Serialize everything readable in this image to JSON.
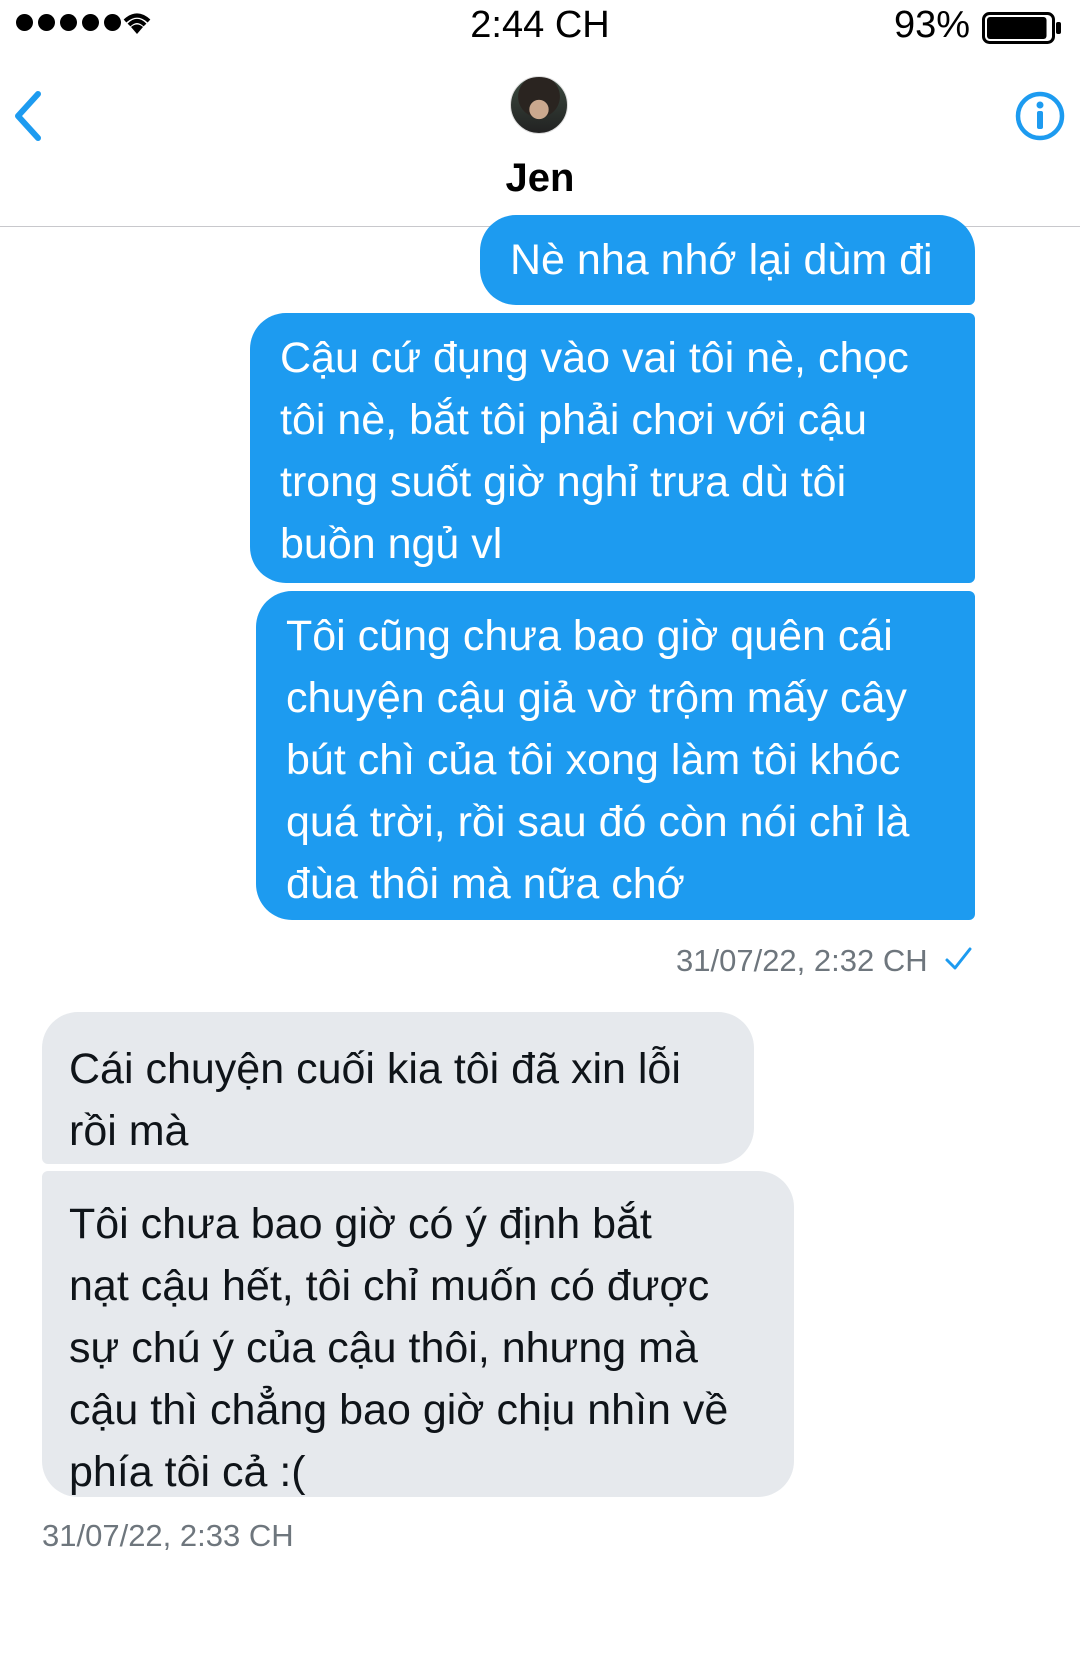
{
  "status_bar": {
    "time": "2:44 CH",
    "battery_percent": "93%",
    "battery_level": 0.93,
    "signal_bars": 5,
    "wifi_icon": "wifi-icon"
  },
  "header": {
    "contact_name": "Jen",
    "back_icon": "chevron-left-icon",
    "info_icon": "info-circle-icon",
    "accent_color": "#1d9bf0"
  },
  "messages": [
    {
      "direction": "sent",
      "text": "Nè nha nhớ lại dùm đi"
    },
    {
      "direction": "sent",
      "text": "Cậu cứ đụng vào vai tôi nè, chọc\ntôi nè, bắt tôi phải chơi với cậu\ntrong suốt giờ nghỉ trưa dù tôi\nbuồn ngủ vl"
    },
    {
      "direction": "sent",
      "text": "Tôi cũng chưa bao giờ quên cái\nchuyện cậu giả vờ trộm mấy cây\nbút chì của tôi xong làm tôi khóc\nquá trời, rồi sau đó còn nói chỉ là\nđùa thôi mà nữa chớ"
    },
    {
      "direction": "received",
      "text": "Cái chuyện cuối kia tôi đã xin lỗi\nrồi mà"
    },
    {
      "direction": "received",
      "text": "Tôi chưa bao giờ có ý định bắt\nnạt cậu hết, tôi chỉ muốn có được\nsự chú ý của cậu thôi, nhưng mà\ncậu thì chẳng bao giờ chịu nhìn về\nphía tôi cả :("
    }
  ],
  "timestamps": {
    "sent_group": "31/07/22, 2:32 CH",
    "received_group": "31/07/22, 2:33 CH"
  },
  "colors": {
    "sent_bubble": "#1d9bf0",
    "received_bubble": "#e6e9ed",
    "timestamp_text": "#6e767d"
  }
}
